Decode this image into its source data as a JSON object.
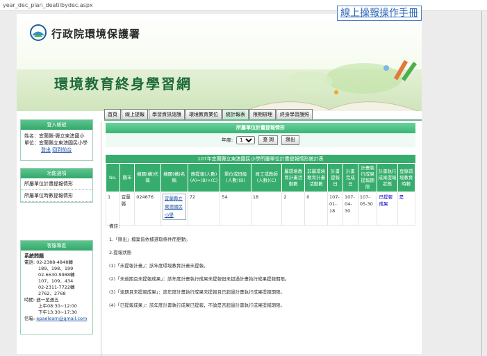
{
  "browser": {
    "url": "year_dec_plan_deatilbydec.aspx"
  },
  "banner": {
    "agency": "行政院環境保護署",
    "manual_link": "線上操報操作手冊",
    "title": "環境教育終身學習網"
  },
  "tabs": [
    {
      "label": "首頁"
    },
    {
      "label": "線上提報"
    },
    {
      "label": "學習資訊總護"
    },
    {
      "label": "環境教育業位"
    },
    {
      "label": "統計報表"
    },
    {
      "label": "限期辦理"
    },
    {
      "label": "終身學習護照"
    }
  ],
  "login": {
    "header": "登入帳號",
    "name_label": "姓名：",
    "name_value": "宜蘭縣-縣立東澳國小",
    "unit_label": "單位：",
    "unit_value": "宜蘭縣立東澳國民小學",
    "logout": "登出",
    "back": "回到前台"
  },
  "func": {
    "header": "功能選項",
    "items": [
      "所屬單位計畫提報情形",
      "所屬單位時數提報情形"
    ]
  },
  "service": {
    "header": "客服專區",
    "system_q": "系統問題",
    "phone_label": "電話:",
    "phone1": "02-2388-4848轉",
    "phone1b": "189、198、199",
    "phone2": "02-6630-9988轉",
    "phone2b": "107、109、434",
    "phone3": "02-2311-7722轉",
    "phone3b": "2762、2768",
    "time_label": "時間:",
    "time1": "週一至週五",
    "time2": "上午08:30~12:00",
    "time3": "下午13:30~17:30",
    "mail_label": "信箱:",
    "mail": "epaelearn@gmail.com"
  },
  "panel": {
    "header": "所屬單位計畫提報情形",
    "year_label": "年度:",
    "year_value": "107",
    "query_btn": "查 詢",
    "export_btn": "匯出"
  },
  "table": {
    "title": "107年宜蘭縣立東澳國民小學所屬單位計畫提報情形統計表",
    "headers": [
      "No.",
      "縣市",
      "機關(構)代碼",
      "機關(構)名稱",
      "應提報(人數)(A)=(B)+(C)",
      "單位或班級(人數)(B)",
      "員工或教師(人數)(C)",
      "屬環境教育計畫活動數",
      "非屬環境教育計畫活動數",
      "計畫提報日",
      "計畫完成日",
      "計畫執行成果提報期限",
      "計畫執行成果提報狀態",
      "登錄環境教育時數"
    ],
    "rows": [
      {
        "no": "1",
        "county": "宜蘭縣",
        "code": "024676",
        "name": "宜蘭縣立東澳國民小學",
        "a": "72",
        "b": "54",
        "c": "18",
        "env": "2",
        "nonenv": "0",
        "submit": "107-01-18",
        "complete": "107-04-30",
        "deadline": "107-05-30",
        "status": "已提報成果",
        "hours": "是"
      }
    ]
  },
  "notes": {
    "heading": "備註：",
    "n1": "1.「匯出」檔案皆依據選取條件而更動。",
    "n2": "2.提報狀態",
    "s1": "(1)「未提報計畫」：該年度環境教育計畫未提報。",
    "s2": "(2)「未逾期且未提報成果」：該年度計畫執行成果未提報但未超過計畫執行成果提報期限。",
    "s3": "(3)「逾期且未提報成果」：該年度計畫執行成果未提報且已超過計畫執行成果提報期限。",
    "s4": "(4)「已提報成果」：該年度計畫執行成果已提報，不論是否超過計畫執行成果提報期限。"
  }
}
